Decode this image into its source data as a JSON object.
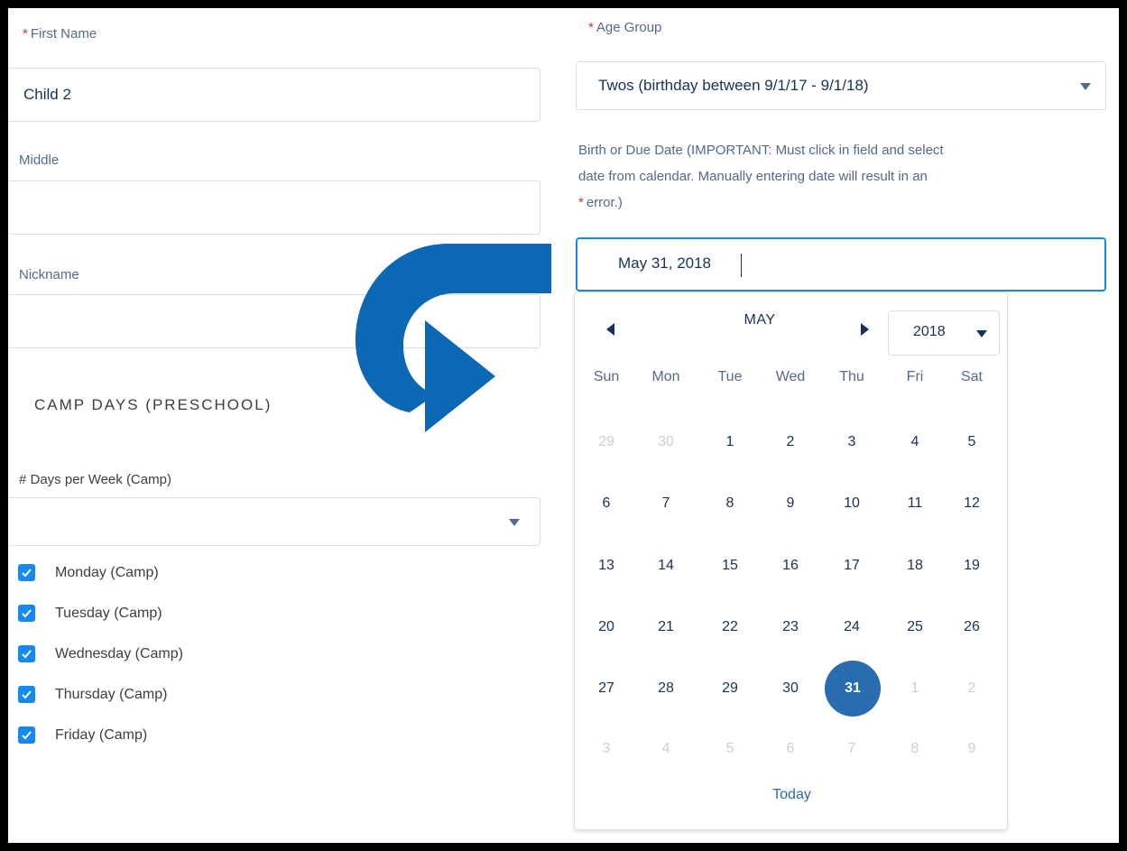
{
  "left_form": {
    "first_name_label": "First Name",
    "first_name_value": "Child 2",
    "middle_label": "Middle",
    "middle_value": "",
    "nickname_label": "Nickname",
    "nickname_value": "",
    "section_title": "CAMP DAYS (PRESCHOOL)",
    "days_per_week_label": "# Days per Week (Camp)",
    "days_per_week_value": "",
    "checkboxes": [
      {
        "label": "Monday (Camp)",
        "checked": true
      },
      {
        "label": "Tuesday (Camp)",
        "checked": true
      },
      {
        "label": "Wednesday (Camp)",
        "checked": true
      },
      {
        "label": "Thursday (Camp)",
        "checked": true
      },
      {
        "label": "Friday (Camp)",
        "checked": true
      }
    ]
  },
  "right_form": {
    "age_group_label": "Age Group",
    "age_group_value": "Twos (birthday between 9/1/17 - 9/1/18)",
    "birth_label_line1": "Birth or Due Date (IMPORTANT: Must click in field and select",
    "birth_label_line2": "date from calendar. Manually entering date will result in an",
    "birth_label_line3": "error.)",
    "birth_value": "May 31, 2018"
  },
  "calendar": {
    "month": "MAY",
    "year": "2018",
    "weekdays": [
      "Sun",
      "Mon",
      "Tue",
      "Wed",
      "Thu",
      "Fri",
      "Sat"
    ],
    "weeks": [
      [
        "29",
        "30",
        "1",
        "2",
        "3",
        "4",
        "5"
      ],
      [
        "6",
        "7",
        "8",
        "9",
        "10",
        "11",
        "12"
      ],
      [
        "13",
        "14",
        "15",
        "16",
        "17",
        "18",
        "19"
      ],
      [
        "20",
        "21",
        "22",
        "23",
        "24",
        "25",
        "26"
      ],
      [
        "27",
        "28",
        "29",
        "30",
        "31",
        "1",
        "2"
      ],
      [
        "3",
        "4",
        "5",
        "6",
        "7",
        "8",
        "9"
      ]
    ],
    "today_label": "Today"
  },
  "colors": {
    "accent": "#1589ee",
    "selected_day": "#2a6cb0",
    "arrow": "#0b68b4",
    "required": "#c23934"
  },
  "icons": {
    "annotation": "curved-arrow-icon",
    "checkbox": "check-icon",
    "select": "chevron-down-icon",
    "prev": "triangle-left-icon",
    "next": "triangle-right-icon"
  }
}
